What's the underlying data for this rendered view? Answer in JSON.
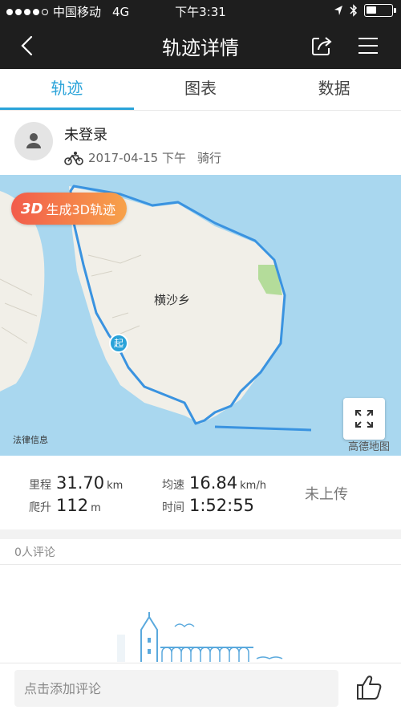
{
  "status_bar": {
    "carrier": "中国移动",
    "network": "4G",
    "time": "下午3:31"
  },
  "nav": {
    "title": "轨迹详情",
    "back_icon": "chevron-left-icon",
    "share_icon": "share-icon",
    "menu_icon": "menu-icon"
  },
  "tabs": [
    {
      "label": "轨迹",
      "active": true
    },
    {
      "label": "图表",
      "active": false
    },
    {
      "label": "数据",
      "active": false
    }
  ],
  "user": {
    "name": "未登录",
    "date": "2017-04-15 下午",
    "activity": "骑行"
  },
  "map": {
    "button_3d_prefix": "3D",
    "button_3d_label": "生成3D轨迹",
    "place_label": "横沙乡",
    "start_label": "起",
    "legal_label": "法律信息",
    "brand_label": "高德地图"
  },
  "stats": {
    "distance": {
      "label": "里程",
      "value": "31.70",
      "unit": "km"
    },
    "avg_speed": {
      "label": "均速",
      "value": "16.84",
      "unit": "km/h"
    },
    "climb": {
      "label": "爬升",
      "value": "112",
      "unit": "m"
    },
    "duration": {
      "label": "时间",
      "value": "1:52:55",
      "unit": ""
    },
    "upload_status": "未上传"
  },
  "comments": {
    "count_label": "0人评论",
    "input_placeholder": "点击添加评论"
  },
  "colors": {
    "accent": "#2aa3d9",
    "nav_background": "#1e1e1e",
    "route": "#3a93e0",
    "water": "#a9d7ef",
    "land": "#f1efe8"
  }
}
